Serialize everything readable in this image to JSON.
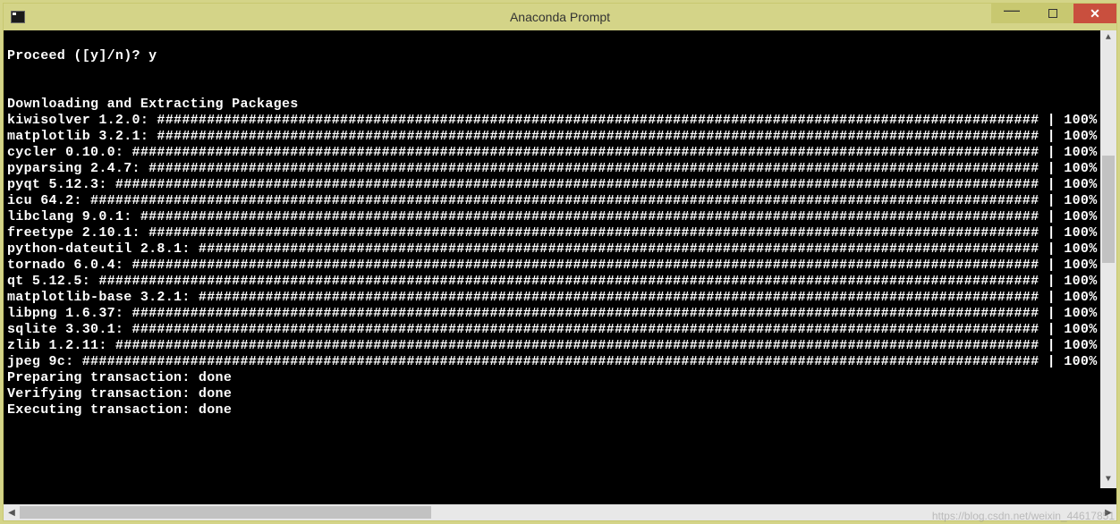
{
  "window": {
    "title": "Anaconda Prompt",
    "minimize_glyph": "—",
    "close_glyph": "✕"
  },
  "terminal": {
    "prompt_line": "Proceed ([y]/n)? y",
    "blank": "",
    "section_header": "Downloading and Extracting Packages",
    "percent_label": "100%",
    "bar_sep": " | ",
    "packages": [
      {
        "name": "kiwisolver 1.2.0",
        "percent": "100%"
      },
      {
        "name": "matplotlib 3.2.1",
        "percent": "100%"
      },
      {
        "name": "cycler 0.10.0",
        "percent": "100%"
      },
      {
        "name": "pyparsing 2.4.7",
        "percent": "100%"
      },
      {
        "name": "pyqt 5.12.3",
        "percent": "100%"
      },
      {
        "name": "icu 64.2",
        "percent": "100%"
      },
      {
        "name": "libclang 9.0.1",
        "percent": "100%"
      },
      {
        "name": "freetype 2.10.1",
        "percent": "100%"
      },
      {
        "name": "python-dateutil 2.8.1",
        "percent": "100%"
      },
      {
        "name": "tornado 6.0.4",
        "percent": "100%"
      },
      {
        "name": "qt 5.12.5",
        "percent": "100%"
      },
      {
        "name": "matplotlib-base 3.2.1",
        "percent": "100%"
      },
      {
        "name": "libpng 1.6.37",
        "percent": "100%"
      },
      {
        "name": "sqlite 3.30.1",
        "percent": "100%"
      },
      {
        "name": "zlib 1.2.11",
        "percent": "100%"
      },
      {
        "name": "jpeg 9c",
        "percent": "100%"
      }
    ],
    "footer_lines": [
      "Preparing transaction: done",
      "Verifying transaction: done",
      "Executing transaction: done"
    ]
  },
  "watermark": "https://blog.csdn.net/weixin_44617851"
}
